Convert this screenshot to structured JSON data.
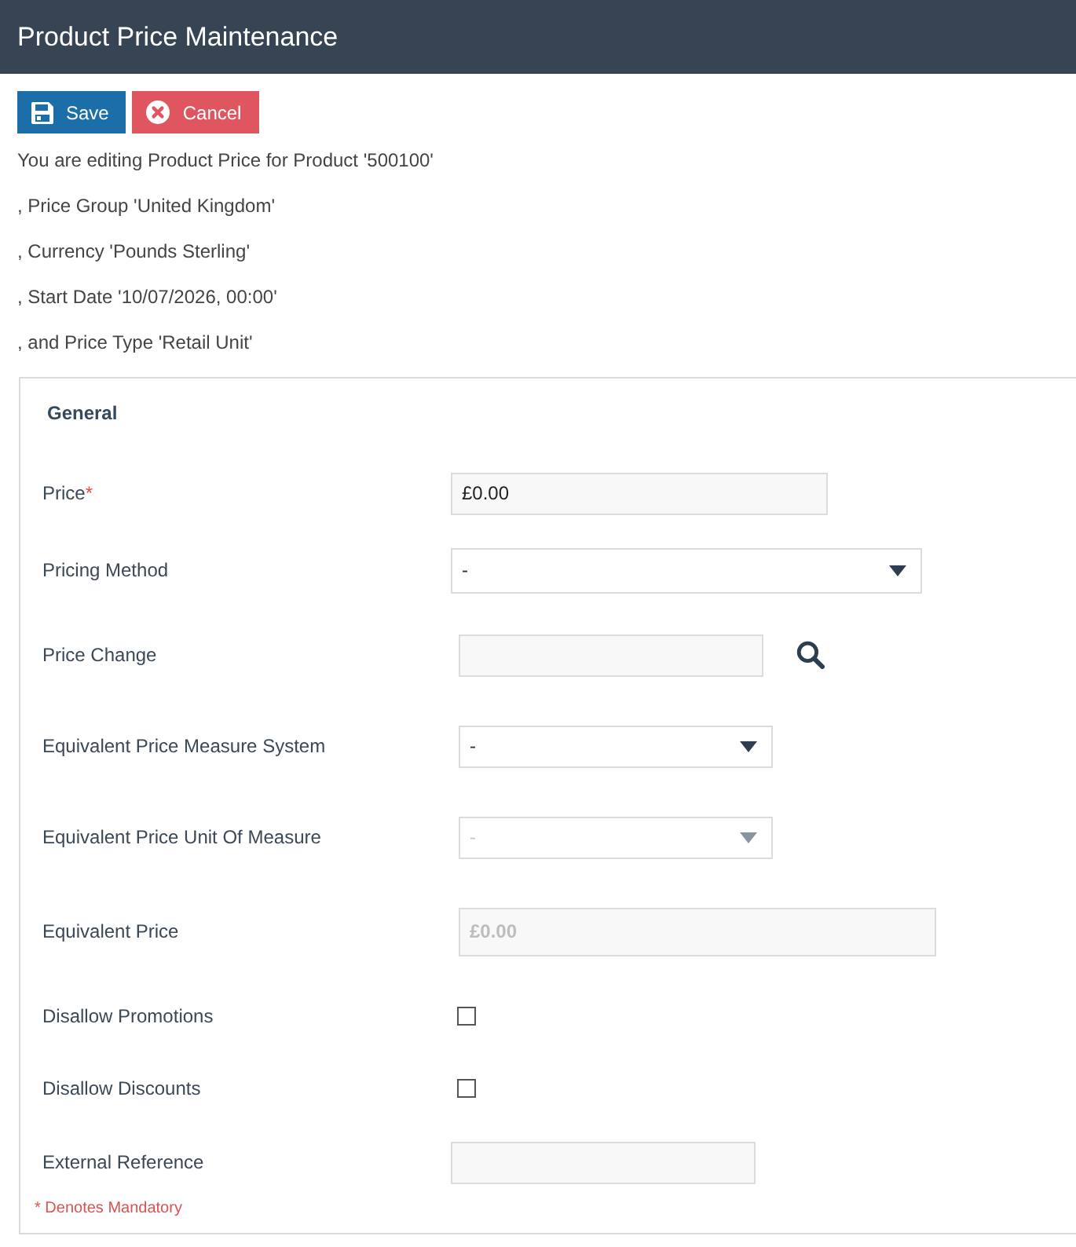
{
  "header": {
    "title": "Product Price Maintenance"
  },
  "toolbar": {
    "buttons": [
      {
        "kind": "save",
        "label": "Save"
      },
      {
        "kind": "cancel",
        "label": "Cancel"
      }
    ]
  },
  "context_lines": [
    "You are editing Product Price for Product '500100'",
    ", Price Group 'United Kingdom'",
    ", Currency 'Pounds Sterling'",
    ", Start Date '10/07/2026, 00:00'",
    ", and Price Type 'Retail Unit'"
  ],
  "panel": {
    "title": "General",
    "fields": [
      {
        "kind": "text",
        "label": "Price",
        "required_mark": "*",
        "value": "£0.00",
        "disabled": false
      },
      {
        "kind": "select",
        "label": "Pricing Method",
        "value": "-",
        "disabled": false
      },
      {
        "kind": "lookup",
        "label": "Price Change"
      },
      {
        "kind": "select",
        "label": "Equivalent Price Measure System",
        "value": "-",
        "disabled": false
      },
      {
        "kind": "select",
        "label": "Equivalent Price Unit Of Measure",
        "value": "-",
        "disabled": true
      },
      {
        "kind": "text",
        "label": "Equivalent Price",
        "value": "£0.00",
        "disabled": true
      },
      {
        "kind": "checkbox",
        "label": "Disallow Promotions",
        "checked": false
      },
      {
        "kind": "checkbox",
        "label": "Disallow Discounts",
        "checked": false
      },
      {
        "kind": "text",
        "label": "External Reference"
      }
    ],
    "footnote": "* Denotes Mandatory"
  }
}
